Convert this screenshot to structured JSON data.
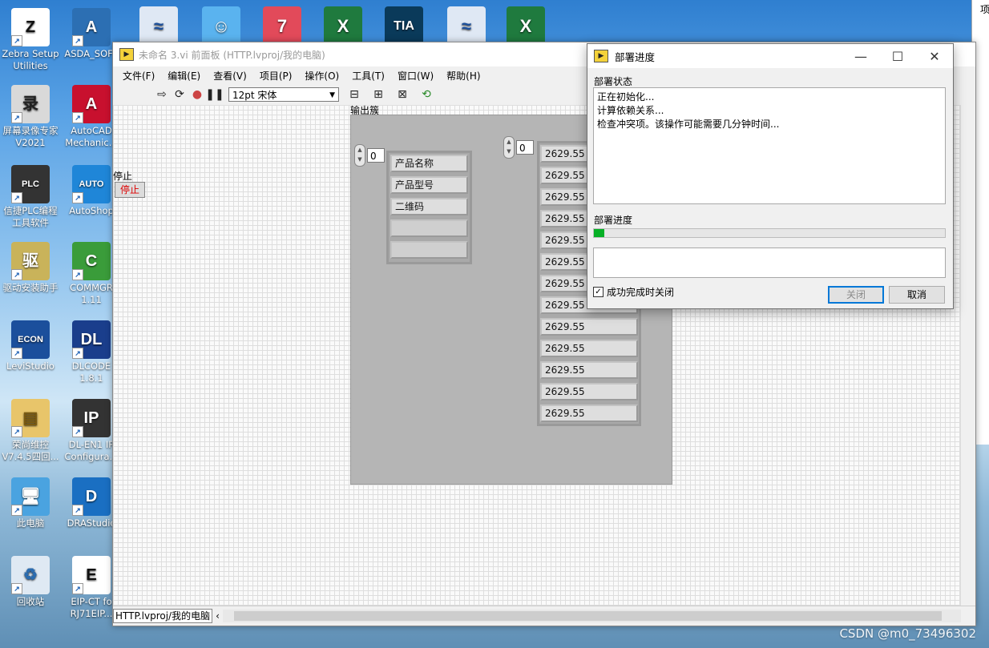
{
  "desktop": {
    "icons": [
      {
        "label": "Zebra Setup\nUtilities",
        "glyph": "Z",
        "color": "#ffffff",
        "fg": "#111111"
      },
      {
        "label": "ASDA_SOFT",
        "glyph": "A",
        "color": "#2c6fb3",
        "fg": "#ffffff"
      },
      {
        "label": "屏幕录像专家\nV2021",
        "glyph": "录",
        "color": "#d9d9d9",
        "fg": "#222222"
      },
      {
        "label": "AutoCAD\nMechanic...",
        "glyph": "A",
        "color": "#c8102e",
        "fg": "#ffffff"
      },
      {
        "label": "信捷PLC编程\n工具软件",
        "glyph": "PLC",
        "color": "#333333",
        "fg": "#ffffff"
      },
      {
        "label": "AutoShop",
        "glyph": "AUTO",
        "color": "#1f86d8",
        "fg": "#ffffff"
      },
      {
        "label": "驱动安装助手",
        "glyph": "驱",
        "color": "#c9b35a",
        "fg": "#ffffff"
      },
      {
        "label": "COMMGR\n1.11",
        "glyph": "C",
        "color": "#3a9c3a",
        "fg": "#ffffff"
      },
      {
        "label": "LeviStudio",
        "glyph": "ECON",
        "color": "#1b4f9c",
        "fg": "#ffffff"
      },
      {
        "label": "DLCODE\n1.8.1",
        "glyph": "DL",
        "color": "#1a3e8c",
        "fg": "#ffffff"
      },
      {
        "label": "荣尚维控\nV7.4.5四回...",
        "glyph": "▤",
        "color": "#e8c56a",
        "fg": "#7a5a10"
      },
      {
        "label": "DL-EN1 IP\nConfigura...",
        "glyph": "IP",
        "color": "#333333",
        "fg": "#ffffff"
      },
      {
        "label": "此电脑",
        "glyph": "🖥",
        "color": "#4aa3e0",
        "fg": "#ffffff"
      },
      {
        "label": "DRAStudio",
        "glyph": "D",
        "color": "#1a6fc2",
        "fg": "#ffffff"
      },
      {
        "label": "回收站",
        "glyph": "♻",
        "color": "#dfe9f3",
        "fg": "#2b6cb0"
      },
      {
        "label": "EIP-CT fo\nRJ71EIP...",
        "glyph": "E",
        "color": "#ffffff",
        "fg": "#111111"
      }
    ],
    "top_icons": [
      {
        "glyph": "≈",
        "color": "#dfe8f4",
        "fg": "#1b4f9c"
      },
      {
        "glyph": "☺",
        "color": "#5ab3ef",
        "fg": "#ffffff"
      },
      {
        "glyph": "7",
        "color": "#e24a5a",
        "fg": "#ffffff"
      },
      {
        "glyph": "X",
        "color": "#1f7a3e",
        "fg": "#ffffff"
      },
      {
        "glyph": "TIA",
        "color": "#0a3a5a",
        "fg": "#ffffff"
      },
      {
        "glyph": "≈",
        "color": "#dfe8f4",
        "fg": "#1b4f9c"
      },
      {
        "glyph": "X",
        "color": "#1f7a3e",
        "fg": "#ffffff"
      }
    ],
    "watermark": "CSDN @m0_73496302"
  },
  "lv_window": {
    "title": "未命名 3.vi 前面板 (HTTP.lvproj/我的电脑)",
    "menus": [
      "文件(F)",
      "编辑(E)",
      "查看(V)",
      "项目(P)",
      "操作(O)",
      "工具(T)",
      "窗口(W)",
      "帮助(H)"
    ],
    "font_select": "12pt 宋体",
    "status_path": "HTTP.lvproj/我的电脑",
    "stop_label": "停止",
    "stop_button": "停止",
    "cluster_label": "输出簇",
    "name_index": "0",
    "names": [
      "产品名称",
      "产品型号",
      "二维码",
      "",
      ""
    ],
    "value_index": "0",
    "values": [
      "2629.55",
      "2629.55",
      "2629.55",
      "2629.55",
      "2629.55",
      "2629.55",
      "2629.55",
      "2629.55",
      "2629.55",
      "2629.55",
      "2629.55",
      "2629.55",
      "2629.55"
    ]
  },
  "deploy_dialog": {
    "title": "部署进度",
    "status_label": "部署状态",
    "log_lines": [
      "正在初始化...",
      "计算依赖关系...",
      "检查冲突项。该操作可能需要几分钟时间..."
    ],
    "progress_label": "部署进度",
    "progress_fraction": 0.03,
    "checkbox_label": "成功完成时关闭",
    "checkbox_checked": true,
    "close_button": "关闭",
    "cancel_button": "取消"
  },
  "right_window": {
    "label": "项"
  }
}
